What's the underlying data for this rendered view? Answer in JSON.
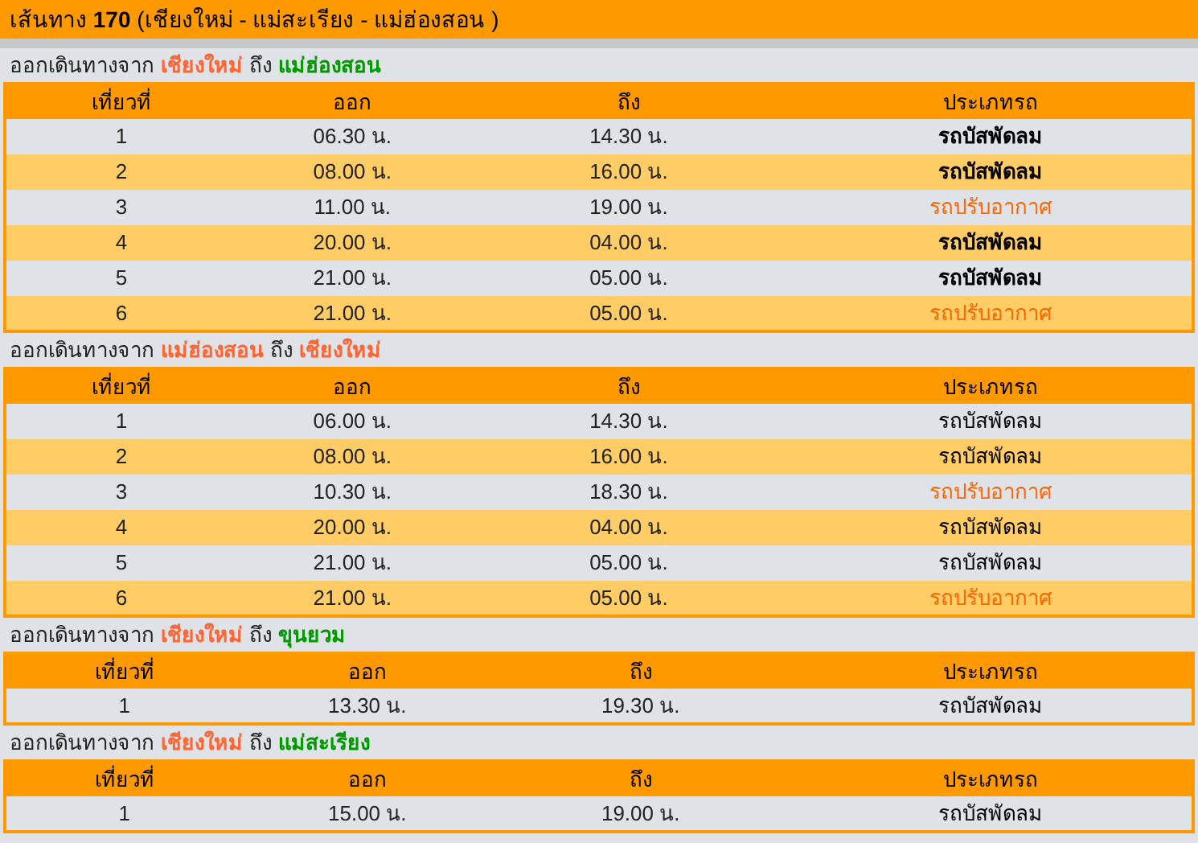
{
  "title": "เส้นทาง **170** (เชียงใหม่ - แม่สะเรียง - แม่ฮ่องสอน )",
  "sections": [
    {
      "prefix": "ออกเดินทางจาก",
      "from": {
        "text": "เชียงใหม่",
        "color": "#ff6633"
      },
      "joiner": "ถึง",
      "to": {
        "text": "แม่ฮ่องสอน",
        "color": "#009900"
      },
      "bold_types": true,
      "columns": [
        "เที่ยวที่",
        "ออก",
        "ถึง",
        "ประเภทรถ"
      ],
      "rows": [
        {
          "trip": "1",
          "depart": "06.30 น.",
          "arrive": "14.30 น.",
          "type": "รถบัสพัดลม",
          "kind": "fan"
        },
        {
          "trip": "2",
          "depart": "08.00 น.",
          "arrive": "16.00 น.",
          "type": "รถบัสพัดลม",
          "kind": "fan"
        },
        {
          "trip": "3",
          "depart": "11.00 น.",
          "arrive": "19.00 น.",
          "type": "รถปรับอากาศ",
          "kind": "air"
        },
        {
          "trip": "4",
          "depart": "20.00 น.",
          "arrive": "04.00 น.",
          "type": "รถบัสพัดลม",
          "kind": "fan"
        },
        {
          "trip": "5",
          "depart": "21.00 น.",
          "arrive": "05.00 น.",
          "type": "รถบัสพัดลม",
          "kind": "fan"
        },
        {
          "trip": "6",
          "depart": "21.00 น.",
          "arrive": "05.00 น.",
          "type": "รถปรับอากาศ",
          "kind": "air"
        }
      ]
    },
    {
      "prefix": "ออกเดินทางจาก",
      "from": {
        "text": "แม่ฮ่องสอน",
        "color": "#ff6633"
      },
      "joiner": "ถึง",
      "to": {
        "text": "เชียงใหม่",
        "color": "#ff6633"
      },
      "bold_types": false,
      "columns": [
        "เที่ยวที่",
        "ออก",
        "ถึง",
        "ประเภทรถ"
      ],
      "rows": [
        {
          "trip": "1",
          "depart": "06.00 น.",
          "arrive": "14.30 น.",
          "type": "รถบัสพัดลม",
          "kind": "fan"
        },
        {
          "trip": "2",
          "depart": "08.00 น.",
          "arrive": "16.00 น.",
          "type": "รถบัสพัดลม",
          "kind": "fan"
        },
        {
          "trip": "3",
          "depart": "10.30 น.",
          "arrive": "18.30 น.",
          "type": "รถปรับอากาศ",
          "kind": "air"
        },
        {
          "trip": "4",
          "depart": "20.00 น.",
          "arrive": "04.00 น.",
          "type": "รถบัสพัดลม",
          "kind": "fan"
        },
        {
          "trip": "5",
          "depart": "21.00 น.",
          "arrive": "05.00 น.",
          "type": "รถบัสพัดลม",
          "kind": "fan"
        },
        {
          "trip": "6",
          "depart": "21.00 น.",
          "arrive": "05.00 น.",
          "type": "รถปรับอากาศ",
          "kind": "air"
        }
      ]
    },
    {
      "prefix": "ออกเดินทางจาก",
      "from": {
        "text": "เชียงใหม่",
        "color": "#ff6633"
      },
      "joiner": "ถึง",
      "to": {
        "text": "ขุนยวม",
        "color": "#009900"
      },
      "bold_types": false,
      "columns": [
        "เที่ยวที่",
        "ออก",
        "ถึง",
        "ประเภทรถ"
      ],
      "rows": [
        {
          "trip": "1",
          "depart": "13.30 น.",
          "arrive": "19.30 น.",
          "type": "รถบัสพัดลม",
          "kind": "fan"
        }
      ]
    },
    {
      "prefix": "ออกเดินทางจาก",
      "from": {
        "text": "เชียงใหม่",
        "color": "#ff6633"
      },
      "joiner": "ถึง",
      "to": {
        "text": "แม่สะเรียง",
        "color": "#009900"
      },
      "bold_types": false,
      "columns": [
        "เที่ยวที่",
        "ออก",
        "ถึง",
        "ประเภทรถ"
      ],
      "rows": [
        {
          "trip": "1",
          "depart": "15.00 น.",
          "arrive": "19.00 น.",
          "type": "รถบัสพัดลม",
          "kind": "fan"
        }
      ]
    }
  ]
}
